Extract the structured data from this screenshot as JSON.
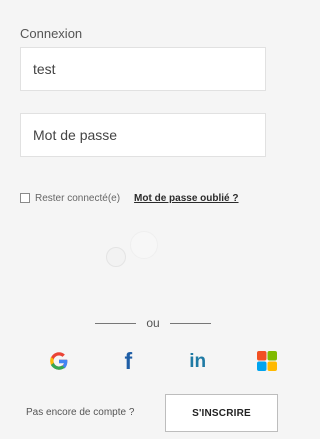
{
  "form": {
    "title": "Connexion",
    "username_value": "test",
    "password_placeholder": "Mot de passe",
    "remember_label": "Rester connecté(e)",
    "remember_checked": false,
    "forgot_label": "Mot de passe oublié ?"
  },
  "divider": {
    "label": "ou"
  },
  "social": {
    "providers": [
      "google-icon",
      "facebook-icon",
      "linkedin-icon",
      "microsoft-icon"
    ],
    "facebook_glyph": "f",
    "linkedin_glyph": "in",
    "colors": {
      "google_blue": "#4285F4",
      "google_red": "#EA4335",
      "google_yellow": "#FBBC05",
      "google_green": "#34A853",
      "facebook": "#1f5ea6",
      "linkedin": "#1f7aa4",
      "ms_red": "#F25022",
      "ms_green": "#7FBA00",
      "ms_blue": "#00A4EF",
      "ms_yellow": "#FFB900"
    }
  },
  "footer": {
    "no_account_text": "Pas encore de compte ?",
    "signup_label": "S'INSCRIRE"
  }
}
